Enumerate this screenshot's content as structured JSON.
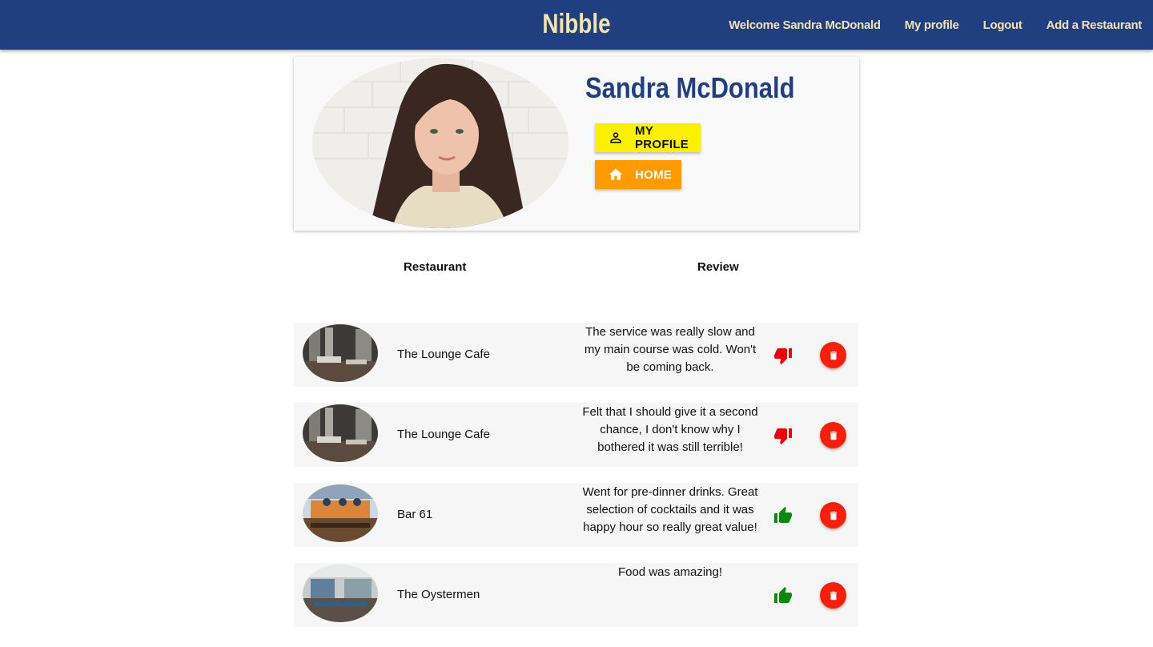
{
  "navbar": {
    "brand": "Nibble",
    "links": [
      "Welcome Sandra McDonald",
      "My profile",
      "Logout",
      "Add a Restaurant"
    ]
  },
  "profile": {
    "name": "Sandra McDonald",
    "my_profile_button": "MY PROFILE",
    "home_button": "HOME"
  },
  "table": {
    "headers": {
      "restaurant": "Restaurant",
      "review": "Review"
    },
    "rows": [
      {
        "restaurant": "The Lounge Cafe",
        "review": "The service was really slow and my main course was cold. Won't be coming back.",
        "rating": "thumbs-down-icon"
      },
      {
        "restaurant": "The Lounge Cafe",
        "review": "Felt that I should give it a second chance, I don't know why I bothered it was still terrible!",
        "rating": "thumbs-down-icon"
      },
      {
        "restaurant": "Bar 61",
        "review": "Went for pre-dinner drinks. Great selection of cocktails and it was happy hour so really great value!",
        "rating": "thumbs-up-icon"
      },
      {
        "restaurant": "The Oystermen",
        "review": "Food was amazing!",
        "rating": "thumbs-up-icon"
      }
    ]
  },
  "colors": {
    "navbar": "#1f3f80",
    "brand_text": "#f3e2b3",
    "my_profile_button": "#fbf000",
    "home_button": "#ff9a00",
    "delete_button": "#f5200c",
    "thumbs_down": "#e8000b",
    "thumbs_up": "#0a8a0a"
  }
}
